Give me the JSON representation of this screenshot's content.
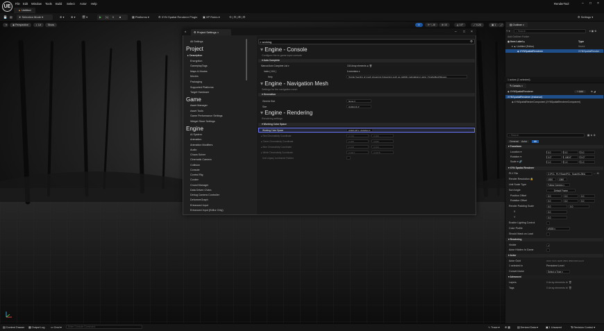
{
  "menu": {
    "items": [
      "File",
      "Edit",
      "Window",
      "Tools",
      "Build",
      "Select",
      "Actor",
      "Help"
    ],
    "app_name": "RenderTool",
    "document_tab": "Untitled",
    "logo": "UE"
  },
  "toolbar": {
    "save_icon": "save-icon",
    "content_icon": "folder-icon",
    "selection_mode": "Selection Mode",
    "play_label": "▶",
    "platforms": "Platforms",
    "plugin_label": "XYN Spatial Renderer Plugin",
    "xp_roles": "XP Roles",
    "settings": "Settings"
  },
  "viewport": {
    "perspective": "Perspective",
    "lit": "Lit",
    "show": "Show"
  },
  "project_settings": {
    "tab_title": "Project Settings",
    "nav": {
      "all_settings": "All Settings",
      "project_header": "Project",
      "project_items": [
        "Description",
        "Encryption",
        "GameplayTags",
        "Maps & Modes",
        "Movies",
        "Packaging",
        "Supported Platforms",
        "Target Hardware"
      ],
      "game_header": "Game",
      "game_items": [
        "Asset Manager",
        "Asset Tools",
        "Game Performance Settings",
        "Widget Store Settings"
      ],
      "engine_header": "Engine",
      "engine_items": [
        "AI System",
        "Animation",
        "Animation Modifiers",
        "Audio",
        "Chaos Solver",
        "Cinematic Camera",
        "Collision",
        "Console",
        "Control Rig",
        "Cooker",
        "Crowd Manager",
        "Data Driven CVars",
        "Debug Camera Controller",
        "DeformerGraph",
        "Enhanced Input",
        "Enhanced Input (Editor Only)"
      ]
    },
    "search_value": "working",
    "sections": [
      {
        "title": "Engine - Console",
        "subtitle": "Configure the in-game input console",
        "category": "Auto Complete",
        "rows": [
          {
            "label": "Manual Auto Complete List",
            "value": "104 Array elements"
          },
          {
            "label": "Index [ 104 ]",
            "value": "6 members"
          },
          {
            "label": "Help",
            "value": "Toggle freezing of mesh streaming (streaming such as visibility calculations) using r.ToggleMeshStream"
          }
        ]
      },
      {
        "title": "Engine - Navigation Mesh",
        "subtitle": "Settings for the navigation mesh",
        "category": "Generation",
        "rows": [
          {
            "label": "Generic Size",
            "value": "None"
          },
          {
            "label": "Size",
            "value": "Uniformly"
          }
        ]
      },
      {
        "title": "Engine - Rendering",
        "subtitle": "Rendering settings",
        "category": "Working Color Space",
        "rows": [
          {
            "label": "Working Color Space",
            "value": "ACES AP1 / ACEScg",
            "highlighted": true
          },
          {
            "label": "Red Chromaticity Coordinate",
            "value": "0.713",
            "value2": "0.293",
            "dim": true
          },
          {
            "label": "Green Chromaticity Coordinate",
            "value": "0.165",
            "value2": "0.830",
            "dim": true
          },
          {
            "label": "Blue Chromaticity Coordinate",
            "value": "0.128",
            "value2": "0.044",
            "dim": true
          },
          {
            "label": "White Chromaticity Coordinate",
            "value": "0.3217",
            "value2": "0.3378",
            "dim": true
          },
          {
            "label": "Use Legacy Luminance Factors",
            "value": "",
            "dim": true
          }
        ]
      }
    ]
  },
  "outliner": {
    "tab": "Outliner",
    "search_placeholder": "Search",
    "col_label": "Item Label",
    "col_type": "Type",
    "rows": [
      {
        "label": "Untitled (Editor)",
        "type": "World"
      },
      {
        "label": "XYNSpatialRenderer",
        "type": "XYNSpatialRender"
      }
    ],
    "count": "1 actors (1 selected)"
  },
  "details": {
    "tab": "Details",
    "actor_name": "XYNSpatialRenderer",
    "add_label": "+ Add",
    "root_component": "XYNSpatialRenderer (Instance)",
    "child_component": "XYNSpatialRenderComponent (XYNSpatialRendererComponent)",
    "search_placeholder": "Search",
    "filter_tabs": [
      "General",
      "Actor",
      "All"
    ],
    "categories": [
      {
        "name": "Transform",
        "rows": [
          {
            "label": "Location",
            "values": [
              "0.0",
              "0.0",
              "0.0"
            ]
          },
          {
            "label": "Rotation",
            "values": [
              "0.0°",
              "-180.0°",
              "0.0°"
            ]
          },
          {
            "label": "Scale",
            "values": [
              "1.0",
              "1.0",
              "1.0"
            ]
          }
        ]
      },
      {
        "name": "XYN Spatial Renderer",
        "rows": [
          {
            "label": "PLY File",
            "values": [
              "C:/PCL_PLY/Scan/PCL_Scan/HLZB/A"
            ]
          },
          {
            "label": "Render Resolution",
            "values": [
              "1920",
              "1080"
            ]
          },
          {
            "label": "Unit Scale Type",
            "values": [
              "Follow Camera"
            ]
          },
          {
            "label": "Sort Angle",
            "values": [
              "Default Frame"
            ]
          },
          {
            "label": "Position Offset",
            "values": [
              "0.0",
              "0.0",
              "0.0"
            ]
          },
          {
            "label": "Rotation Offset",
            "values": [
              "0.0",
              "0.0",
              "0.0"
            ]
          },
          {
            "label": "Render Padding Scale",
            "values": [
              "0.0",
              "0.0"
            ]
          },
          {
            "label": "X",
            "values": [
              "0.0"
            ]
          },
          {
            "label": "Y",
            "values": [
              "0.0"
            ]
          },
          {
            "label": "Enable Lighting Control",
            "values": [
              ""
            ]
          },
          {
            "label": "Color Profile",
            "values": [
              "sRGB"
            ]
          },
          {
            "label": "Should Mask on Load",
            "values": [
              ""
            ]
          }
        ]
      },
      {
        "name": "Rendering",
        "rows": [
          {
            "label": "Visible",
            "values": [
              ""
            ]
          },
          {
            "label": "Actor Hidden In Game",
            "values": [
              ""
            ]
          }
        ]
      },
      {
        "name": "Actor",
        "rows": [
          {
            "label": "Actor Guid",
            "values": [
              "0000 7A0C 4E6B 2B84 3B9F0060 E1A3"
            ]
          },
          {
            "label": "1 selected in",
            "values": [
              "Persistent Level"
            ]
          },
          {
            "label": "Convert Actor",
            "values": [
              "Select a Type"
            ]
          }
        ]
      },
      {
        "name": "Advanced",
        "rows": [
          {
            "label": "Layers",
            "values": [
              "0 Array elements"
            ]
          },
          {
            "label": "Tags",
            "values": [
              "0 Array elements"
            ]
          }
        ]
      }
    ]
  },
  "statusbar": {
    "content_drawer": "Content Drawer",
    "output_log": "Output Log",
    "cmd": "Cmd",
    "cmd_placeholder": "Enter Console Command",
    "trace": "Trace",
    "derived_data": "Derived Data",
    "unsaved": "1 Unsaved",
    "revision_control": "Revision Control"
  },
  "colors": {
    "accent": "#6b78ff",
    "selection": "#1f4f8a",
    "panel": "#1b1b1b"
  }
}
